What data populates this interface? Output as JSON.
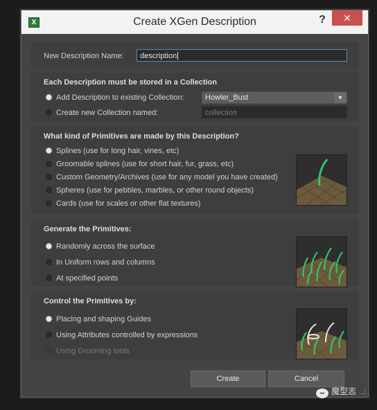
{
  "window": {
    "title": "Create XGen Description",
    "help_label": "?",
    "close_label": "✕",
    "app_icon_label": "X"
  },
  "name_row": {
    "label": "New Description Name:",
    "value": "description"
  },
  "collection": {
    "heading": "Each Description must be stored in a Collection",
    "add_existing_label": "Add Description to existing Collection:",
    "existing_value": "Howler_Bust",
    "create_new_label": "Create new Collection named:",
    "new_placeholder": "collection"
  },
  "primitives": {
    "heading": "What kind of Primitives are made by this Description?",
    "options": [
      "Splines (use for long hair, vines, etc)",
      "Groomable splines (use for short hair, fur, grass, etc)",
      "Custom Geometry/Archives (use for any model you have created)",
      "Spheres (use for pebbles, marbles, or other round objects)",
      "Cards (use for scales or other flat textures)"
    ]
  },
  "generate": {
    "heading": "Generate the Primitives:",
    "options": [
      "Randomly across the surface",
      "In Uniform rows and columns",
      "At specified points"
    ]
  },
  "control": {
    "heading": "Control the Primitives by:",
    "options": [
      "Placing and shaping Guides",
      "Using Attributes controlled by expressions",
      "Using Grooming tools"
    ]
  },
  "buttons": {
    "create": "Create",
    "cancel": "Cancel"
  },
  "watermark": {
    "text": "魔型志"
  },
  "colors": {
    "accent_green": "#35c46a",
    "close_red": "#c9504c",
    "focus_border": "#5b8ab5"
  }
}
